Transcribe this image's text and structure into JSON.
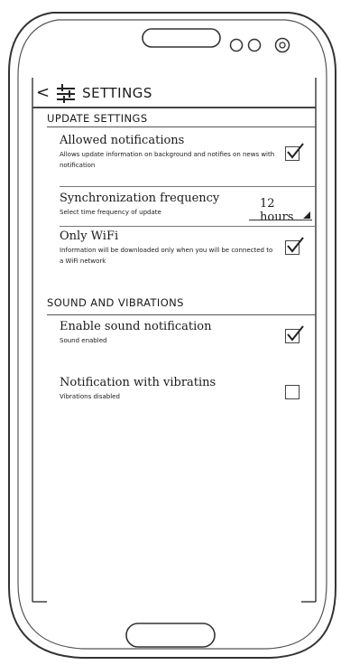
{
  "header": {
    "back_glyph": "<",
    "title": "SETTINGS"
  },
  "sections": {
    "update": {
      "title": "UPDATE SETTINGS",
      "allowed_notifications": {
        "title": "Allowed notifications",
        "desc": "Allows update information on background and notifies on news with notification",
        "checked": true
      },
      "sync_frequency": {
        "title": "Synchronization frequency",
        "desc": "Select time frequency of update",
        "value": "12 hours"
      },
      "only_wifi": {
        "title": "Only WiFi",
        "desc": "Information will be downloaded only when you will be connected to a WiFi network",
        "checked": true
      }
    },
    "sound": {
      "title": "SOUND AND VIBRATIONS",
      "enable_sound": {
        "title": "Enable sound notification",
        "desc": "Sound enabled",
        "checked": true
      },
      "vibrations": {
        "title": "Notification with vibratins",
        "desc": "Vibrations disabled",
        "checked": false
      }
    }
  }
}
